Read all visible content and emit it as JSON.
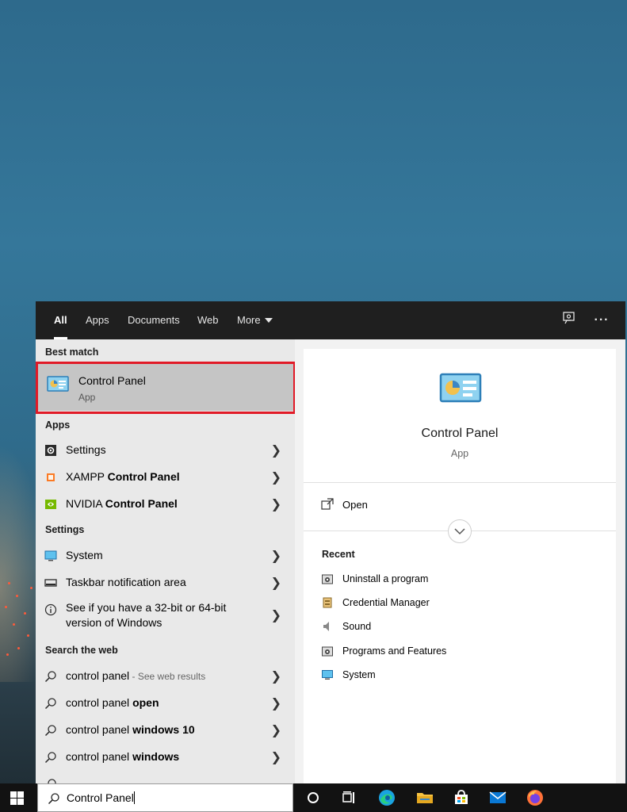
{
  "tabs": [
    {
      "label": "All"
    },
    {
      "label": "Apps"
    },
    {
      "label": "Documents"
    },
    {
      "label": "Web"
    },
    {
      "label": "More"
    }
  ],
  "left": {
    "best_match_heading": "Best match",
    "best_match": {
      "title": "Control Panel",
      "subtitle": "App"
    },
    "apps_heading": "Apps",
    "apps": [
      {
        "label": "Settings",
        "icon": "gear-icon"
      },
      {
        "prefix": "XAMPP ",
        "bold": "Control Panel",
        "icon": "xampp-icon"
      },
      {
        "prefix": "NVIDIA ",
        "bold": "Control Panel",
        "icon": "nvidia-icon"
      }
    ],
    "settings_heading": "Settings",
    "settings": [
      {
        "label": "System",
        "icon": "monitor-icon"
      },
      {
        "label": "Taskbar notification area",
        "icon": "taskbar-icon"
      },
      {
        "line1": "See if you have a 32-bit or 64-bit",
        "line2": "version of Windows",
        "icon": "info-icon"
      }
    ],
    "web_heading": "Search the web",
    "web": [
      {
        "prefix": "control panel",
        "note": " - See web results",
        "bold": ""
      },
      {
        "prefix": "control panel ",
        "bold": "open"
      },
      {
        "prefix": "control panel ",
        "bold": "windows 10"
      },
      {
        "prefix": "control panel ",
        "bold": "windows"
      }
    ]
  },
  "right": {
    "title": "Control Panel",
    "subtitle": "App",
    "open_label": "Open",
    "recent_heading": "Recent",
    "recent": [
      {
        "label": "Uninstall a program"
      },
      {
        "label": "Credential Manager"
      },
      {
        "label": "Sound"
      },
      {
        "label": "Programs and Features"
      },
      {
        "label": "System"
      }
    ]
  },
  "taskbar": {
    "search_value": "Control Panel"
  }
}
